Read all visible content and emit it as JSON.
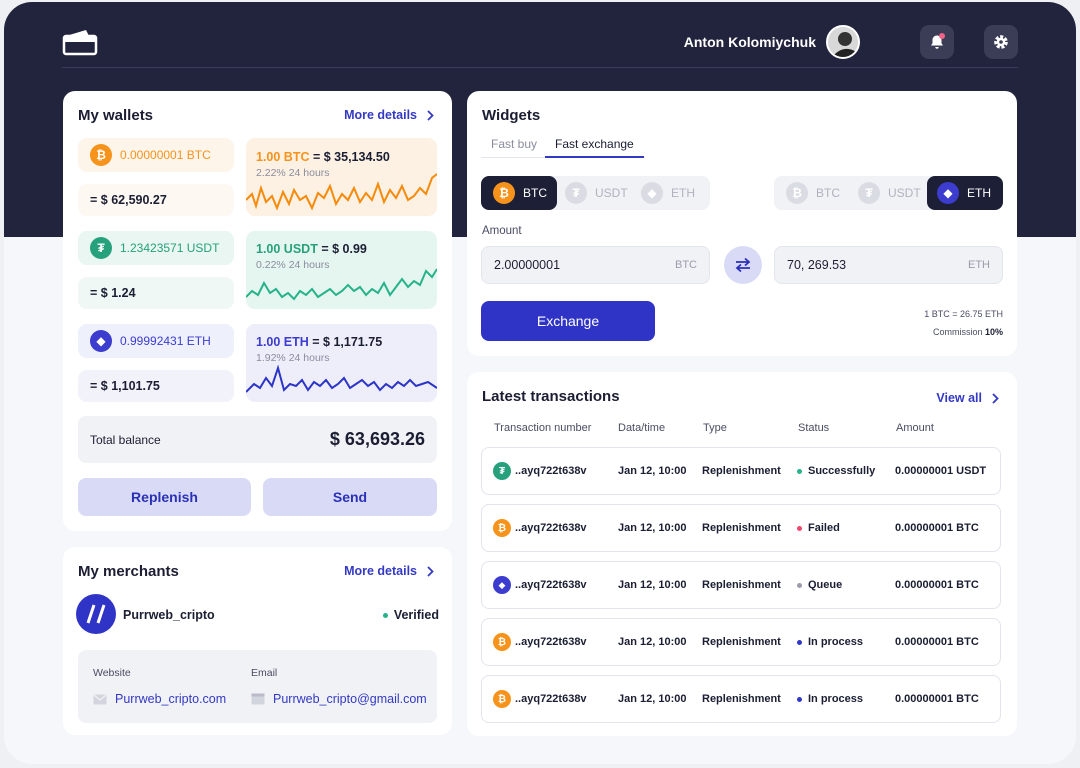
{
  "header": {
    "user_name": "Anton Kolomiychuk"
  },
  "wallets": {
    "title": "My wallets",
    "more": "More details",
    "items": [
      {
        "amount": "0.00000001 BTC",
        "usd": "= $ 62,590.27",
        "rate_coin": "1.00 BTC",
        "rate_value": " = $ 35,134.50",
        "change": "2.22% 24 hours",
        "color": "#f7931a"
      },
      {
        "amount": "1.23423571 USDT",
        "usd": "= $ 1.24",
        "rate_coin": "1.00 USDT",
        "rate_value": " = $ 0.99",
        "change": "0.22% 24 hours",
        "color": "#26a17b"
      },
      {
        "amount": "0.99992431 ETH",
        "usd": "= $ 1,101.75",
        "rate_coin": "1.00 ETH",
        "rate_value": " = $ 1,171.75",
        "change": "1.92% 24 hours",
        "color": "#3c3ccf"
      }
    ],
    "total_label": "Total balance",
    "total_value": "$ 63,693.26",
    "replenish": "Replenish",
    "send": "Send"
  },
  "merchants": {
    "title": "My merchants",
    "more": "More details",
    "name": "Purrweb_cripto",
    "status": "Verified",
    "website_label": "Website",
    "website": "Purrweb_cripto.com",
    "email_label": "Email",
    "email": "Purrweb_cripto@gmail.com"
  },
  "widgets": {
    "title": "Widgets",
    "tabs": [
      "Fast buy",
      "Fast exchange"
    ],
    "from_coins": [
      "BTC",
      "USDT",
      "ETH"
    ],
    "to_coins": [
      "BTC",
      "USDT",
      "ETH"
    ],
    "amount_label": "Amount",
    "from_value": "2.00000001",
    "from_unit": "BTC",
    "to_value": "70, 269.53",
    "to_unit": "ETH",
    "exchange": "Exchange",
    "rate": "1 BTC = 26.75 ETH",
    "commission_label": "Commission ",
    "commission_value": "10%"
  },
  "transactions": {
    "title": "Latest transactions",
    "view_all": "View all",
    "headers": [
      "Transaction number",
      "Data/time",
      "Type",
      "Status",
      "Amount"
    ],
    "rows": [
      {
        "coin": "usdt",
        "id": "..ayq722t638v",
        "date": "Jan 12, 10:00",
        "type": "Replenishment",
        "status": "Successfully",
        "status_color": "#26b38a",
        "amount": "0.00000001 USDT"
      },
      {
        "coin": "btc",
        "id": "..ayq722t638v",
        "date": "Jan 12, 10:00",
        "type": "Replenishment",
        "status": "Failed",
        "status_color": "#f0476e",
        "amount": "0.00000001 BTC"
      },
      {
        "coin": "eth",
        "id": "..ayq722t638v",
        "date": "Jan 12, 10:00",
        "type": "Replenishment",
        "status": "Queue",
        "status_color": "#9a9cab",
        "amount": "0.00000001 BTC"
      },
      {
        "coin": "btc",
        "id": "..ayq722t638v",
        "date": "Jan 12, 10:00",
        "type": "Replenishment",
        "status": "In process",
        "status_color": "#2f38c8",
        "amount": "0.00000001 BTC"
      },
      {
        "coin": "btc",
        "id": "..ayq722t638v",
        "date": "Jan 12, 10:00",
        "type": "Replenishment",
        "status": "In process",
        "status_color": "#2f38c8",
        "amount": "0.00000001 BTC"
      }
    ]
  }
}
